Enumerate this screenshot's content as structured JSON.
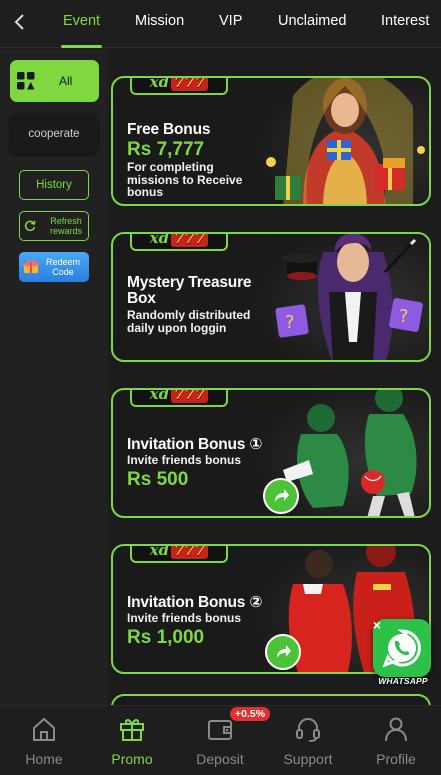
{
  "topnav": {
    "tabs": [
      {
        "label": "Event",
        "active": true
      },
      {
        "label": "Mission",
        "active": false
      },
      {
        "label": "VIP",
        "active": false
      },
      {
        "label": "Unclaimed",
        "active": false
      },
      {
        "label": "Interest",
        "active": false
      }
    ]
  },
  "sidebar": {
    "all_label": "All",
    "cooperate_label": "cooperate",
    "history_label": "History",
    "refresh_label": "Refresh rewards",
    "redeem_label": "Redeem Code"
  },
  "banners": [
    {
      "logo_a": "xd",
      "logo_b": "777",
      "title": "Free Bonus",
      "amount": "Rs 7,777",
      "subtitle": "For completing missions to Receive bonus"
    },
    {
      "logo_a": "xd",
      "logo_b": "777",
      "title": "Mystery Treasure Box",
      "amount": "",
      "subtitle": "Randomly distributed daily upon loggin"
    },
    {
      "logo_a": "xd",
      "logo_b": "777",
      "title": "Invitation Bonus ①",
      "amount": "Rs 500",
      "subtitle": "Invite friends bonus"
    },
    {
      "logo_a": "xd",
      "logo_b": "777",
      "title": "Invitation Bonus ②",
      "amount": "Rs 1,000",
      "subtitle": "Invite friends bonus"
    }
  ],
  "whatsapp": {
    "label": "WHATSAPP"
  },
  "bottomnav": {
    "items": [
      {
        "label": "Home",
        "active": false
      },
      {
        "label": "Promo",
        "active": true
      },
      {
        "label": "Deposit",
        "active": false
      },
      {
        "label": "Support",
        "active": false
      },
      {
        "label": "Profile",
        "active": false
      }
    ],
    "deposit_badge": "+0.5%"
  },
  "colors": {
    "accent": "#7fd840",
    "background": "#1c1c1c",
    "badge": "#e03030",
    "whatsapp": "#2ec14a"
  }
}
